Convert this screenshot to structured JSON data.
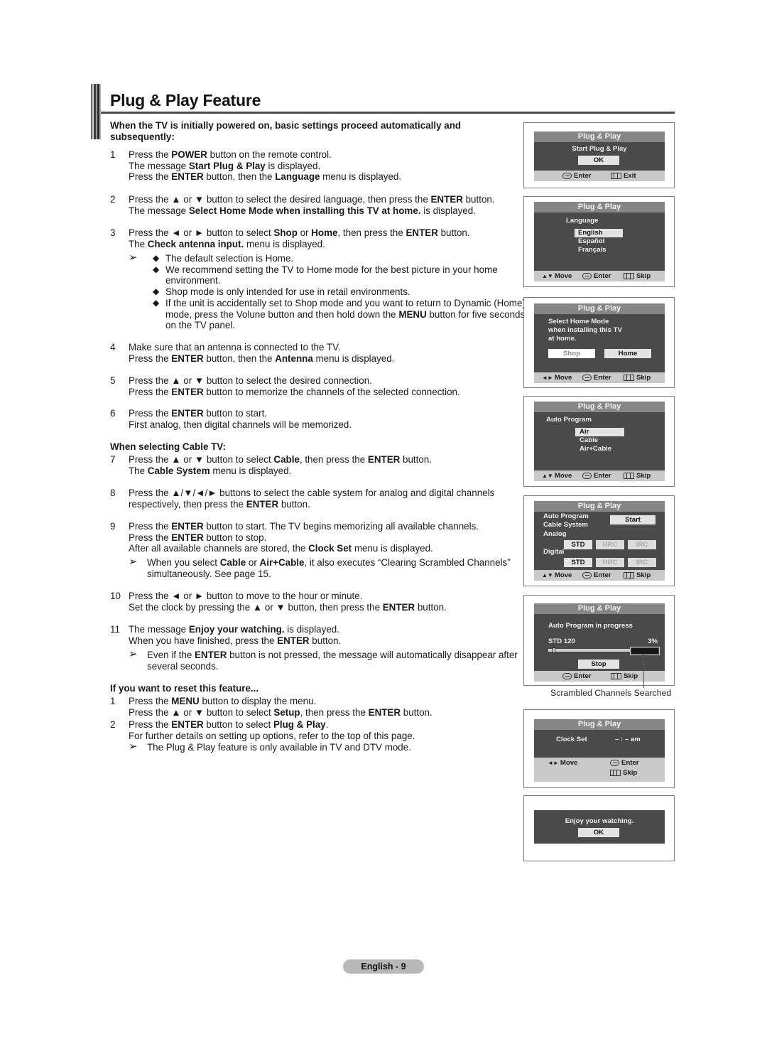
{
  "page": {
    "title": "Plug & Play Feature",
    "intro": "When the TV is initially powered on, basic settings proceed automatically and subsequently:",
    "footer_badge": "English - 9"
  },
  "steps": [
    {
      "num": "1",
      "lines": [
        [
          {
            "t": "Press the "
          },
          {
            "t": "POWER",
            "b": true
          },
          {
            "t": " button on the remote control."
          }
        ],
        [
          {
            "t": "The message "
          },
          {
            "t": "Start Plug & Play",
            "b": true
          },
          {
            "t": " is displayed."
          }
        ],
        [
          {
            "t": "Press the "
          },
          {
            "t": "ENTER",
            "b": true
          },
          {
            "t": " button, then the "
          },
          {
            "t": "Language",
            "b": true
          },
          {
            "t": " menu is displayed."
          }
        ]
      ]
    },
    {
      "num": "2",
      "lines": [
        [
          {
            "t": "Press the ▲ or ▼ button to select the desired language, then press the "
          },
          {
            "t": "ENTER",
            "b": true
          },
          {
            "t": " button."
          }
        ],
        [
          {
            "t": "The message "
          },
          {
            "t": "Select Home Mode when installing this TV at home.",
            "b": true
          },
          {
            "t": " is displayed."
          }
        ]
      ]
    },
    {
      "num": "3",
      "lines": [
        [
          {
            "t": "Press the ◄ or ► button to select "
          },
          {
            "t": "Shop",
            "b": true
          },
          {
            "t": " or "
          },
          {
            "t": "Home",
            "b": true
          },
          {
            "t": ", then press the "
          },
          {
            "t": "ENTER",
            "b": true
          },
          {
            "t": " button."
          }
        ],
        [
          {
            "t": "The "
          },
          {
            "t": "Check antenna input.",
            "b": true
          },
          {
            "t": " menu is displayed."
          }
        ]
      ]
    },
    {
      "num": "4",
      "lines": [
        [
          {
            "t": "Make sure that an antenna is connected to the TV."
          }
        ],
        [
          {
            "t": "Press the "
          },
          {
            "t": "ENTER",
            "b": true
          },
          {
            "t": " button, then the "
          },
          {
            "t": "Antenna",
            "b": true
          },
          {
            "t": " menu is displayed."
          }
        ]
      ]
    },
    {
      "num": "5",
      "lines": [
        [
          {
            "t": "Press the ▲ or ▼ button to select the desired connection."
          }
        ],
        [
          {
            "t": "Press the "
          },
          {
            "t": "ENTER",
            "b": true
          },
          {
            "t": " button to memorize the channels of the selected connection."
          }
        ]
      ]
    },
    {
      "num": "6",
      "lines": [
        [
          {
            "t": "Press the "
          },
          {
            "t": "ENTER",
            "b": true
          },
          {
            "t": " button to start."
          }
        ],
        [
          {
            "t": "First analog, then digital channels will be memorized."
          }
        ]
      ]
    },
    {
      "num": "7",
      "lines": [
        [
          {
            "t": "Press the ▲ or ▼ button to select "
          },
          {
            "t": "Cable",
            "b": true
          },
          {
            "t": ", then press the "
          },
          {
            "t": "ENTER",
            "b": true
          },
          {
            "t": " button."
          }
        ],
        [
          {
            "t": "The "
          },
          {
            "t": "Cable System",
            "b": true
          },
          {
            "t": " menu is displayed."
          }
        ]
      ]
    },
    {
      "num": "8",
      "lines": [
        [
          {
            "t": "Press the ▲/▼/◄/► buttons to select the cable system for analog and digital channels"
          }
        ],
        [
          {
            "t": "respectively, then press the "
          },
          {
            "t": "ENTER",
            "b": true
          },
          {
            "t": " button."
          }
        ]
      ]
    },
    {
      "num": "9",
      "lines": [
        [
          {
            "t": "Press the "
          },
          {
            "t": "ENTER",
            "b": true
          },
          {
            "t": " button to start. The TV begins memorizing all available channels."
          }
        ],
        [
          {
            "t": "Press the "
          },
          {
            "t": "ENTER",
            "b": true
          },
          {
            "t": " button to stop."
          }
        ],
        [
          {
            "t": "After all available channels are stored, the "
          },
          {
            "t": "Clock Set",
            "b": true
          },
          {
            "t": " menu is displayed."
          }
        ]
      ]
    },
    {
      "num": "10",
      "lines": [
        [
          {
            "t": "Press the ◄ or ► button to move to the hour or minute."
          }
        ],
        [
          {
            "t": "Set the clock by pressing the ▲ or ▼ button, then press the "
          },
          {
            "t": "ENTER",
            "b": true
          },
          {
            "t": " button."
          }
        ]
      ]
    },
    {
      "num": "11",
      "lines": [
        [
          {
            "t": "The message "
          },
          {
            "t": "Enjoy your watching.",
            "b": true
          },
          {
            "t": " is displayed."
          }
        ],
        [
          {
            "t": "When you have finished, press the "
          },
          {
            "t": "ENTER",
            "b": true
          },
          {
            "t": " button."
          }
        ]
      ]
    }
  ],
  "step3_bullets": [
    "The default selection is Home.",
    "We recommend setting the TV to Home mode for the best picture in your home environment.",
    "Shop mode is only intended for use in retail environments.",
    [
      {
        "t": "If the unit is accidentally set to Shop mode and you want to return to Dynamic (Home) mode, press the Volune button and then hold down the "
      },
      {
        "t": "MENU",
        "b": true
      },
      {
        "t": " button for five seconds on the TV panel."
      }
    ]
  ],
  "notes": {
    "arrow_glyph": "➢",
    "bullet_glyph": "◆",
    "step9": [
      {
        "t": "When you select "
      },
      {
        "t": "Cable",
        "b": true
      },
      {
        "t": " or "
      },
      {
        "t": "Air+Cable",
        "b": true
      },
      {
        "t": ", it also executes “Clearing Scrambled Channels” simultaneously. See page 15."
      }
    ],
    "step11": [
      {
        "t": "Even if the "
      },
      {
        "t": "ENTER",
        "b": true
      },
      {
        "t": " button is not pressed, the message will automatically disappear after several seconds."
      }
    ],
    "reset": [
      {
        "t": "The Plug & Play feature is only available in TV and DTV mode."
      }
    ]
  },
  "cable_heading": "When selecting Cable TV:",
  "reset": {
    "heading": "If you want to reset this feature...",
    "steps": [
      {
        "num": "1",
        "lines": [
          [
            {
              "t": "Press the "
            },
            {
              "t": "MENU",
              "b": true
            },
            {
              "t": " button to display the menu."
            }
          ],
          [
            {
              "t": "Press the ▲ or ▼ button to select "
            },
            {
              "t": "Setup",
              "b": true
            },
            {
              "t": ", then press the "
            },
            {
              "t": "ENTER",
              "b": true
            },
            {
              "t": " button."
            }
          ]
        ]
      },
      {
        "num": "2",
        "lines": [
          [
            {
              "t": "Press the "
            },
            {
              "t": "ENTER",
              "b": true
            },
            {
              "t": " button to select "
            },
            {
              "t": "Plug & Play",
              "b": true
            },
            {
              "t": "."
            }
          ],
          [
            {
              "t": "For further details on setting up options, refer to the top of this page."
            }
          ]
        ]
      }
    ]
  },
  "osd": {
    "title": "Plug & Play",
    "labels": {
      "enter": "Enter",
      "exit": "Exit",
      "skip": "Skip",
      "move": "Move"
    },
    "start": {
      "message": "Start Plug & Play",
      "ok": "OK"
    },
    "language": {
      "label": "Language",
      "options": [
        "English",
        "Español",
        "Français"
      ],
      "selected": "English"
    },
    "home_mode": {
      "message": [
        "Select Home Mode",
        "when installing this TV",
        "at home."
      ],
      "options": [
        "Shop",
        "Home"
      ],
      "selected": "Home"
    },
    "auto_program": {
      "label": "Auto Program",
      "options": [
        "Air",
        "Cable",
        "Air+Cable"
      ],
      "selected": "Air"
    },
    "cable_system": {
      "auto_program": "Auto Program",
      "cable_system": "Cable System",
      "start": "Start",
      "analog": "Analog",
      "digital": "Digital",
      "systems": [
        "STD",
        "HRC",
        "IRC"
      ],
      "selected_analog": "STD",
      "selected_digital": "STD"
    },
    "progress": {
      "message": "Auto Program in progress",
      "channel": "STD 120",
      "percent_label": "3%",
      "percent": 3,
      "stop": "Stop",
      "caption": "Scrambled Channels Searched"
    },
    "clock": {
      "label": "Clock Set",
      "value": "– : – am"
    },
    "enjoy": {
      "message": "Enjoy your watching.",
      "ok": "OK"
    }
  }
}
